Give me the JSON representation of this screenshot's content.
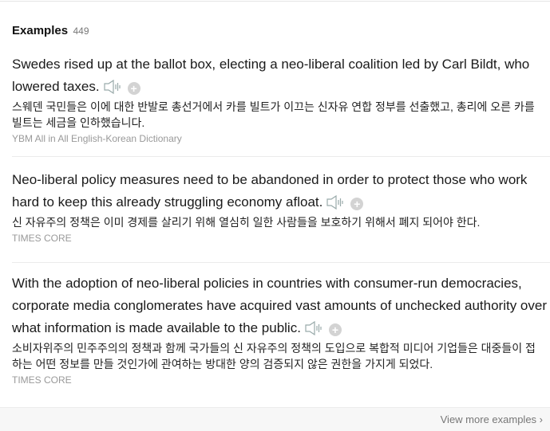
{
  "section": {
    "title": "Examples",
    "count": "449"
  },
  "examples": [
    {
      "en": "Swedes rised up at the ballot box, electing a neo-liberal coalition led by Carl Bildt, who lowered taxes.",
      "ko": "스웨덴 국민들은 이에 대한 반발로 총선거에서 카를 빌트가 이끄는 신자유 연합 정부를 선출했고, 총리에 오른 카를 빌트는 세금을 인하했습니다.",
      "source": "YBM All in All English-Korean Dictionary"
    },
    {
      "en": "Neo-liberal policy measures need to be abandoned in order to protect those who work hard to keep this already struggling economy afloat.",
      "ko": "신 자유주의 정책은 이미 경제를 살리기 위해 열심히 일한 사람들을 보호하기 위해서 폐지 되어야 한다.",
      "source": "TIMES CORE"
    },
    {
      "en": "With the adoption of neo-liberal policies in countries with consumer-run democracies, corporate media conglomerates have acquired vast amounts of unchecked authority over what information is made available to the public.",
      "ko": "소비자위주의 민주주의의 정책과 함께 국가들의 신 자유주의 정책의 도입으로 복합적 미디어 기업들은 대중들이 접하는 어떤 정보를 만들 것인가에 관여하는 방대한 양의 검증되지 않은 권한을 가지게 되었다.",
      "source": "TIMES CORE"
    }
  ],
  "footer": {
    "view_more": "View more examples ›"
  }
}
